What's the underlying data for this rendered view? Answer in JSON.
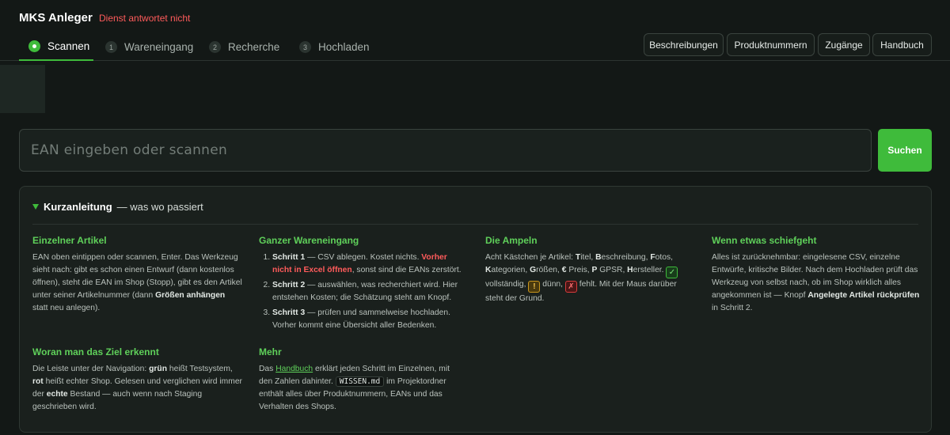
{
  "header": {
    "app_title": "MKS Anleger",
    "service_status": "Dienst antwortet nicht"
  },
  "nav": {
    "tabs": [
      {
        "label": "Scannen",
        "step": ""
      },
      {
        "label": "Wareneingang",
        "step": "1"
      },
      {
        "label": "Recherche",
        "step": "2"
      },
      {
        "label": "Hochladen",
        "step": "3"
      }
    ],
    "buttons": [
      "Beschreibungen",
      "Produktnummern",
      "Zugänge",
      "Handbuch"
    ]
  },
  "search": {
    "placeholder": "EAN eingeben oder scannen",
    "value": "",
    "button_label": "Suchen"
  },
  "guide": {
    "title": "Kurzanleitung",
    "subtitle": "— was wo passiert",
    "single": {
      "title": "Einzelner Artikel",
      "t1": "EAN oben eintippen oder scannen, Enter. Das Werkzeug sieht nach: gibt es schon einen Entwurf (dann kostenlos öffnen), steht die EAN im Shop (Stopp), gibt es den Artikel unter seiner Artikelnummer (dann ",
      "b1": "Größen anhängen",
      "t2": " statt neu anlegen)."
    },
    "bulk": {
      "title": "Ganzer Wareneingang",
      "s1_label": "Schritt 1",
      "s1_text": " — CSV ablegen. Kostet nichts. ",
      "s1_warn": "Vorher nicht in Excel öffnen",
      "s1_text2": ", sonst sind die EANs zerstört.",
      "s2_label": "Schritt 2",
      "s2_text": " — auswählen, was recherchiert wird. Hier entstehen Kosten; die Schätzung steht am Knopf.",
      "s3_label": "Schritt 3",
      "s3_text": " — prüfen und sammelweise hochladen. Vorher kommt eine Übersicht aller Bedenken."
    },
    "lights": {
      "title": "Die Ampeln",
      "t1": "Acht Kästchen je Artikel: ",
      "k1": "T",
      "w1": "itel, ",
      "k2": "B",
      "w2": "eschreibung, ",
      "k3": "F",
      "w3": "otos, ",
      "k4": "K",
      "w4": "ategorien, ",
      "k5": "G",
      "w5": "rößen, ",
      "k6": "€",
      "w6": " Preis, ",
      "k7": "P",
      "w7": " GPSR, ",
      "k8": "H",
      "w8": "ersteller. ",
      "ok_symbol": "✓",
      "ok_text": " vollständig, ",
      "thin_symbol": "!",
      "thin_text": " dünn, ",
      "missing_symbol": "✗",
      "missing_text": " fehlt. Mit der Maus darüber steht der Grund."
    },
    "errors": {
      "title": "Wenn etwas schiefgeht",
      "t1": "Alles ist zurücknehmbar: eingelesene CSV, einzelne Entwürfe, kritische Bilder. Nach dem Hochladen prüft das Werkzeug von selbst nach, ob im Shop wirklich alles angekommen ist — Knopf ",
      "b1": "Angelegte Artikel rückprüfen",
      "t2": " in Schritt 2."
    },
    "target": {
      "title": "Woran man das Ziel erkennt",
      "t1": "Die Leiste unter der Navigation: ",
      "b1": "grün",
      "t2": " heißt Testsystem, ",
      "b2": "rot",
      "t3": " heißt echter Shop. Gelesen und verglichen wird immer der ",
      "b3": "echte",
      "t4": " Bestand — auch wenn nach Staging geschrieben wird."
    },
    "more": {
      "title": "Mehr",
      "t1": "Das ",
      "link": "Handbuch",
      "t2": " erklärt jeden Schritt im Einzelnen, mit den Zahlen dahinter. ",
      "code": "WISSEN.md",
      "t3": " im Projektordner enthält alles über Produktnummern, EANs und das Verhalten des Shops."
    }
  },
  "colors": {
    "accent": "#3fbb3b",
    "error": "#ff5b5b",
    "background": "#131816"
  }
}
